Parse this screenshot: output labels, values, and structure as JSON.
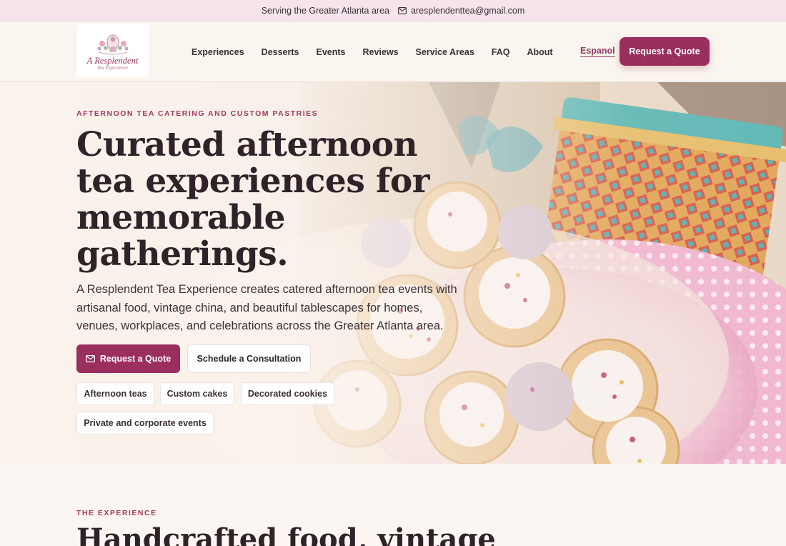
{
  "topbar": {
    "service_area": "Serving the Greater Atlanta area",
    "email": "aresplendenttea@gmail.com",
    "icons": [
      "mail-icon"
    ]
  },
  "header": {
    "logo": {
      "line1": "A Resplendent",
      "line2": "Tea Experience"
    },
    "nav": [
      "Experiences",
      "Desserts",
      "Events",
      "Reviews",
      "Service Areas",
      "FAQ",
      "About"
    ],
    "language_link": "Espanol",
    "quote_button": "Request a Quote"
  },
  "hero": {
    "eyebrow": "AFTERNOON TEA CATERING AND CUSTOM PASTRIES",
    "headline": "Curated afternoon tea experiences for memorable gatherings.",
    "description": "A Resplendent Tea Experience creates catered afternoon tea events with artisanal food, vintage china, and beautiful tablescapes for homes, venues, workplaces, and celebrations across the Greater Atlanta area.",
    "primary_button": "Request a Quote",
    "secondary_button": "Schedule a Consultation",
    "tags": [
      "Afternoon teas",
      "Custom cakes",
      "Decorated cookies",
      "Private and corporate events"
    ]
  },
  "experience": {
    "eyebrow": "THE EXPERIENCE",
    "heading": "Handcrafted food, vintage"
  },
  "colors": {
    "accent": "#9a2e5c",
    "topbar_bg": "#f6e4ec",
    "page_bg": "#fbf6f1",
    "heading": "#2f2329"
  }
}
